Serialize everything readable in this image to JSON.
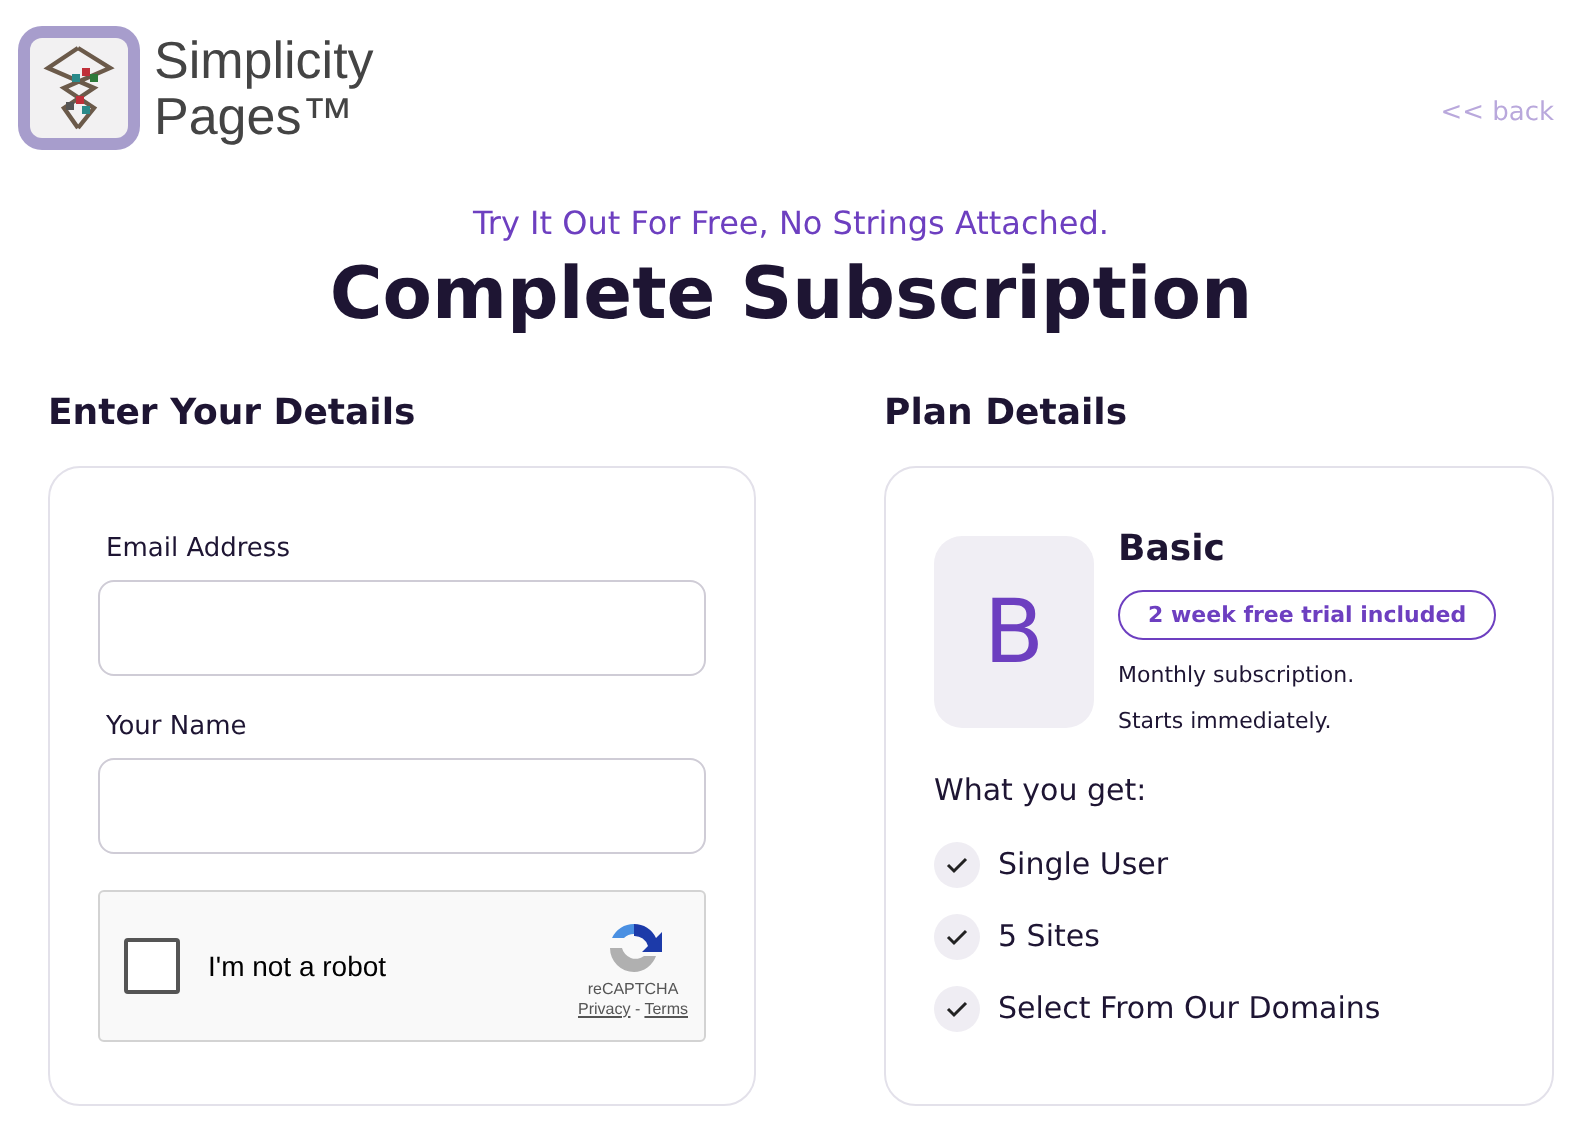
{
  "logo": {
    "lines": [
      "Simplicity",
      "Pages™"
    ]
  },
  "back_link": "<< back",
  "tagline": "Try It Out For Free, No Strings Attached.",
  "title": "Complete Subscription",
  "details": {
    "heading": "Enter Your Details",
    "fields": [
      {
        "label": "Email Address"
      },
      {
        "label": "Your Name"
      }
    ],
    "recaptcha": {
      "label": "I'm not a robot",
      "checked": false,
      "brand": "reCAPTCHA",
      "links": [
        "Privacy",
        "Terms"
      ],
      "separator": "-"
    }
  },
  "plan": {
    "heading": "Plan Details",
    "initial": "B",
    "name": "Basic",
    "badge": "2 week free trial included",
    "notes": [
      "Monthly subscription.",
      "Starts immediately."
    ],
    "features_heading": "What you get:",
    "features": [
      "Single User",
      "5 Sites",
      "Select From Our Domains"
    ]
  }
}
